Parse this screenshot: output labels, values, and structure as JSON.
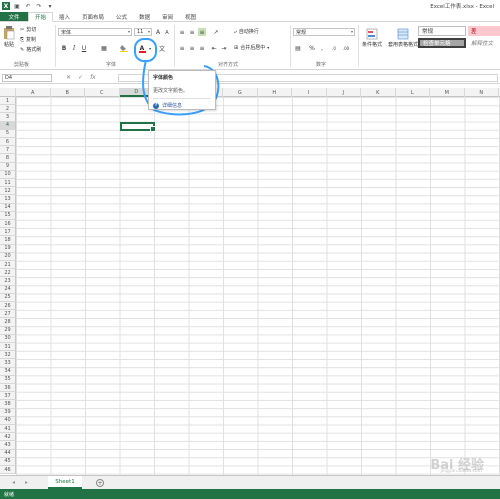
{
  "titlebar": {
    "app_icon": "X",
    "qat": [
      "save-icon",
      "undo-icon",
      "redo-icon",
      "customize-icon"
    ],
    "window_title": "Excel工作表.xlsx - Excel"
  },
  "tabs": [
    {
      "label": "文件"
    },
    {
      "label": "开始"
    },
    {
      "label": "插入"
    },
    {
      "label": "页面布局"
    },
    {
      "label": "公式"
    },
    {
      "label": "数据"
    },
    {
      "label": "审阅"
    },
    {
      "label": "视图"
    }
  ],
  "ribbon": {
    "clipboard": {
      "paste": "粘贴",
      "cut": "剪切",
      "copy": "复制",
      "format_painter": "格式刷",
      "label": "剪贴板"
    },
    "font": {
      "name": "宋体",
      "size": "11",
      "bold": "B",
      "italic": "I",
      "underline": "U",
      "font_color_letter": "A",
      "grow": "A",
      "shrink": "A",
      "wen": "文",
      "label": "字体"
    },
    "alignment": {
      "wrap": "自动换行",
      "merge": "合并后居中",
      "label": "对齐方式"
    },
    "number": {
      "format": "常规",
      "percent": "%",
      "comma": ",",
      "label": "数字"
    },
    "styles": {
      "conditional": "条件格式",
      "table": "套用表格格式",
      "normal": "常规",
      "bad": "差",
      "check_cell": "检查单元格",
      "explanatory": "解释性文"
    }
  },
  "formula_bar": {
    "name_box": "D4",
    "fx": "fx",
    "cancel": "✕",
    "enter": "✓"
  },
  "grid": {
    "columns": [
      "A",
      "B",
      "C",
      "D",
      "E",
      "F",
      "G",
      "H",
      "I",
      "J",
      "K",
      "L",
      "M",
      "N"
    ],
    "rows": [
      "1",
      "2",
      "3",
      "4",
      "5",
      "6",
      "7",
      "8",
      "9",
      "10",
      "11",
      "12",
      "13",
      "14",
      "15",
      "16",
      "17",
      "18",
      "19",
      "20",
      "21",
      "22",
      "23",
      "24",
      "25",
      "26",
      "27",
      "28",
      "29",
      "30",
      "31",
      "32",
      "33",
      "34",
      "35",
      "36",
      "37",
      "38",
      "39",
      "40",
      "41",
      "42",
      "43",
      "44",
      "45",
      "46"
    ],
    "selected_col": "D",
    "selected_row": "4"
  },
  "tooltip": {
    "title": "字体颜色",
    "description": "更改文字颜色。",
    "more": "详细信息",
    "help_glyph": "?"
  },
  "sheets": {
    "tabs": [
      "Sheet1"
    ],
    "add": "+"
  },
  "status": {
    "text": "就绪"
  },
  "watermark": {
    "text": "Bai 经验",
    "url": "jingyan.baidu.com"
  },
  "colors": {
    "accent": "#217346",
    "annotation": "#3aa0ff",
    "font_color_red": "#e02020",
    "fill_yellow": "#ffd400",
    "style_normal_bg": "#ffffff",
    "style_bad_bg": "#ffc7ce",
    "style_check_bg": "#a5a5a5"
  }
}
